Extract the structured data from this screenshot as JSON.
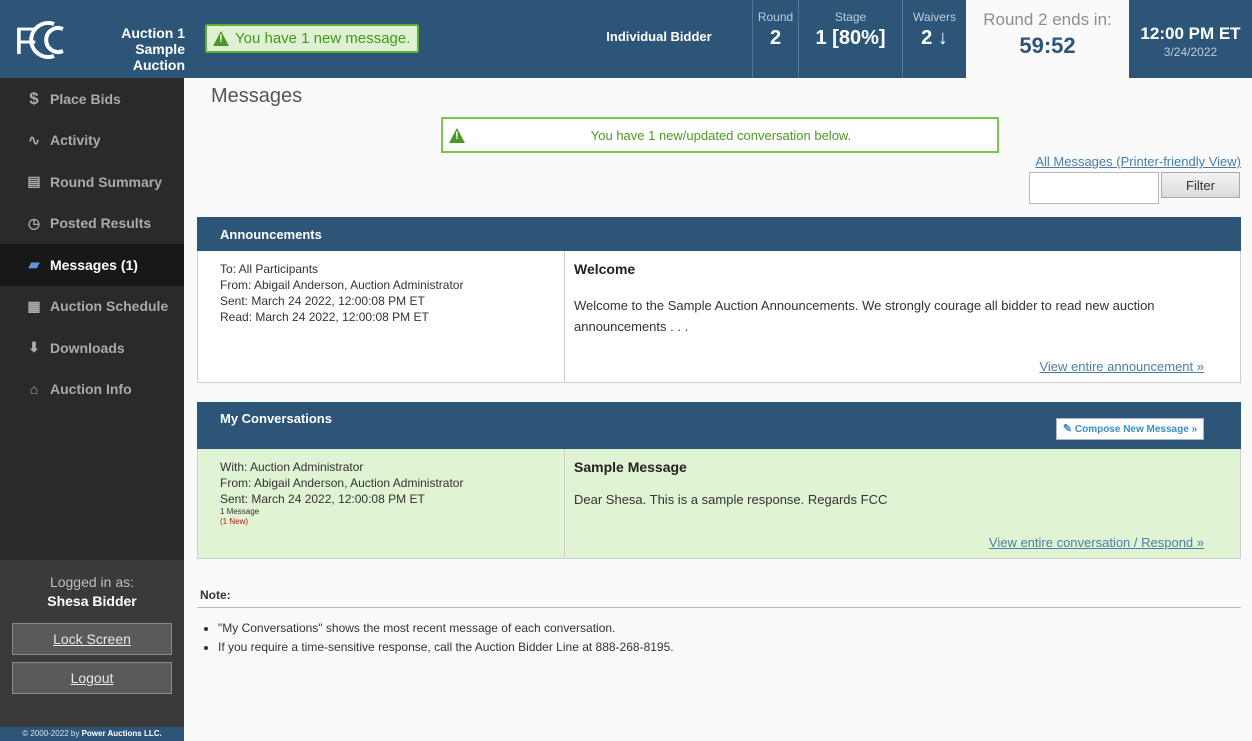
{
  "header": {
    "logo_text": "FCC",
    "auction_title": "Auction 1",
    "auction_subtitle": "Sample Auction",
    "new_message": "You have 1 new message.",
    "bidder_type": "Individual Bidder",
    "round_label": "Round",
    "round_value": "2",
    "stage_label": "Stage",
    "stage_value": "1 [80%]",
    "waivers_label": "Waivers",
    "waivers_value": "2 ↓",
    "countdown_label": "Round 2 ends in:",
    "countdown_value": "59:52",
    "time": "12:00 PM ET",
    "date": "3/24/2022"
  },
  "sidebar": {
    "items": [
      {
        "label": "Place Bids",
        "icon": "$"
      },
      {
        "label": "Activity",
        "icon": "∿"
      },
      {
        "label": "Round Summary",
        "icon": "▤"
      },
      {
        "label": "Posted Results",
        "icon": "◷"
      },
      {
        "label": "Messages (1)",
        "icon": "▰"
      },
      {
        "label": "Auction Schedule",
        "icon": "▦"
      },
      {
        "label": "Downloads",
        "icon": "⬇"
      },
      {
        "label": "Auction Info",
        "icon": "⌂"
      }
    ],
    "logged_in_label": "Logged in as:",
    "user_name": "Shesa Bidder",
    "lock_label": "Lock Screen",
    "logout_label": "Logout",
    "copyright_prefix": "© 2000-2022 by ",
    "copyright_company": "Power Auctions LLC."
  },
  "main": {
    "title": "Messages",
    "banner": "You have 1 new/updated conversation below.",
    "print_link": "All Messages (Printer-friendly View)",
    "filter_value": "",
    "filter_button": "Filter",
    "announcements": {
      "heading": "Announcements",
      "to": "To: All Participants",
      "from": "From: Abigail Anderson, Auction Administrator",
      "sent": "Sent: March 24 2022, 12:00:08 PM ET",
      "read": "Read: March 24 2022, 12:00:08 PM ET",
      "subject": "Welcome",
      "body": "Welcome to the Sample Auction Announcements. We strongly courage all bidder to read new auction announcements . . .",
      "link": "View entire announcement »"
    },
    "conversations": {
      "heading": "My Conversations",
      "compose": "Compose New Message »",
      "with": "With: Auction Administrator",
      "from": "From: Abigail Anderson, Auction Administrator",
      "sent": "Sent: March 24 2022, 12:00:08 PM ET",
      "count": "1 Message",
      "new": "(1 New)",
      "subject": "Sample Message",
      "body": "Dear Shesa. This is a sample response. Regards FCC",
      "link": "View entire conversation / Respond »"
    },
    "note_title": "Note:",
    "notes": [
      "\"My Conversations\" shows the most recent message of each conversation.",
      "If you require a time-sensitive response, call the Auction Bidder Line at 888-268-8195."
    ]
  }
}
